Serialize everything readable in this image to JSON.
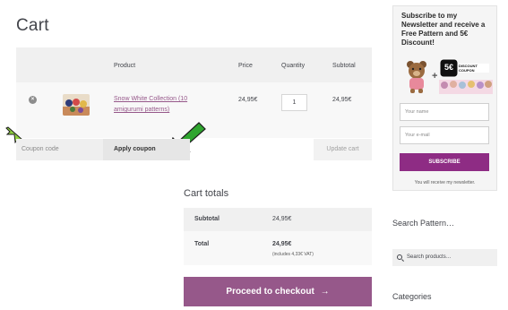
{
  "cart": {
    "title": "Cart",
    "headers": {
      "product": "Product",
      "price": "Price",
      "quantity": "Quantity",
      "subtotal": "Subtotal"
    },
    "items": [
      {
        "remove": "×",
        "name": "Snow White Collection (10 amigurumi patterns)",
        "price": "24,95€",
        "quantity": "1",
        "subtotal": "24,95€"
      }
    ],
    "coupon_placeholder": "Coupon code",
    "apply_label": "Apply coupon",
    "update_label": "Update cart"
  },
  "totals": {
    "title": "Cart totals",
    "subtotal_label": "Subtotal",
    "subtotal_value": "24,95€",
    "total_label": "Total",
    "total_value": "24,95€",
    "total_note": "(includes 4,33€ VAT)",
    "checkout_label": "Proceed to checkout"
  },
  "newsletter": {
    "title": "Subscribe to my Newsletter and receive a Free Pattern and 5€ Discount!",
    "coupon_value": "5€",
    "coupon_caption_1": "DISCOUNT",
    "coupon_caption_2": "COUPON",
    "name_placeholder": "Your name",
    "email_placeholder": "Your e-mail",
    "subscribe_label": "SUBSCRIBE",
    "note": "You will receive my newsletter."
  },
  "sidebar": {
    "search_title": "Search Pattern…",
    "search_placeholder": "Search products…",
    "categories_title": "Categories"
  },
  "colors": {
    "accent": "#96588a",
    "subscribe": "#8e2c84",
    "arrow": "#2fa52f"
  },
  "icons": {
    "remove": "remove-icon",
    "search": "search-icon",
    "arrows": "green-arrow-icon"
  }
}
